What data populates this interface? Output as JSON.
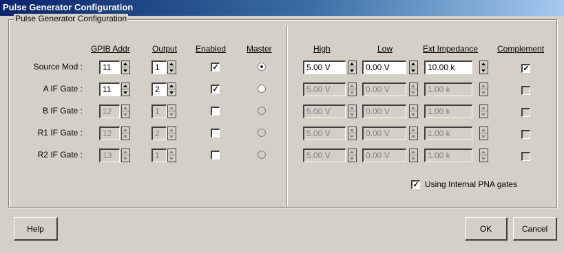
{
  "window": {
    "title": "Pulse Generator Configuration"
  },
  "group": {
    "label": "Pulse Generator Configuration"
  },
  "headers": {
    "gpib": "GPIB Addr",
    "output": "Output",
    "enabled": "Enabled",
    "master": "Master",
    "high": "High",
    "low": "Low",
    "ext_impedance": "Ext Impedance",
    "complement": "Complement"
  },
  "rows": [
    {
      "label": "Source Mod :",
      "gpib": "11",
      "output": "1",
      "enabled": true,
      "master": true,
      "high": "5.00 V",
      "low": "0.00 V",
      "imp": "10.00 k",
      "complement": true,
      "active": true
    },
    {
      "label": "A IF Gate :",
      "gpib": "11",
      "output": "2",
      "enabled": true,
      "master": false,
      "high": "5.00 V",
      "low": "0.00 V",
      "imp": "1.00 k",
      "complement": false,
      "active": true
    },
    {
      "label": "B IF Gate :",
      "gpib": "12",
      "output": "1",
      "enabled": false,
      "master": false,
      "high": "5.00 V",
      "low": "0.00 V",
      "imp": "1.00 k",
      "complement": false,
      "active": false
    },
    {
      "label": "R1 IF Gate :",
      "gpib": "12",
      "output": "2",
      "enabled": false,
      "master": false,
      "high": "5.00 V",
      "low": "0.00 V",
      "imp": "1.00 k",
      "complement": false,
      "active": false
    },
    {
      "label": "R2 IF Gate :",
      "gpib": "13",
      "output": "1",
      "enabled": false,
      "master": false,
      "high": "5.00 V",
      "low": "0.00 V",
      "imp": "1.00 k",
      "complement": false,
      "active": false
    }
  ],
  "internal_gates": {
    "label": "Using Internal PNA gates",
    "checked": true
  },
  "buttons": {
    "help": "Help",
    "ok": "OK",
    "cancel": "Cancel"
  }
}
